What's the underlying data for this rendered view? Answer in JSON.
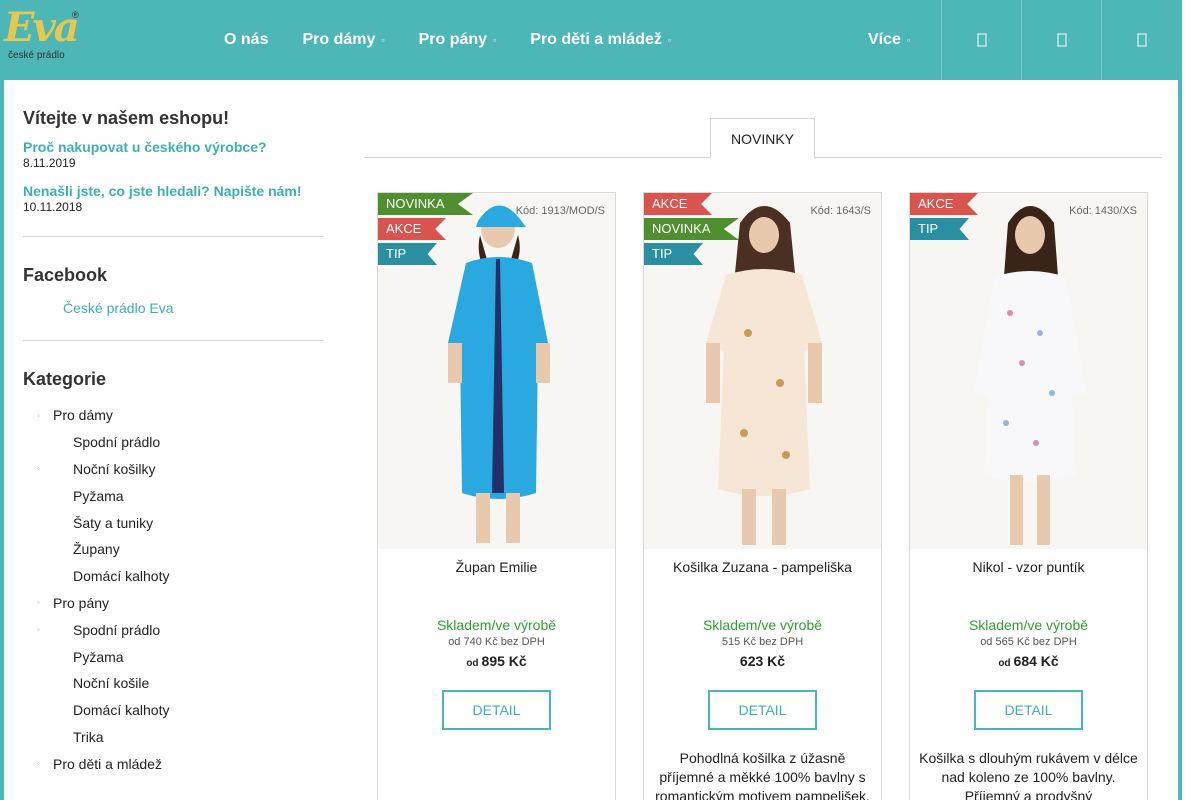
{
  "header": {
    "logo_text": "Eva",
    "logo_reg": "®",
    "logo_sub": "české prádlo",
    "nav": [
      "O nás",
      "Pro dámy",
      "Pro pány",
      "Pro děti a mládež"
    ],
    "nav_more": "Více",
    "icons": [
      "search-icon",
      "user-icon",
      "cart-icon"
    ]
  },
  "sidebar": {
    "welcome_title": "Vítejte v našem eshopu!",
    "news": [
      {
        "title": "Proč nakupovat u českého výrobce?",
        "date": "8.11.2019"
      },
      {
        "title": "Nenašli jste, co jste hledali? Napište nám!",
        "date": "10.11.2018"
      }
    ],
    "facebook_title": "Facebook",
    "facebook_link": "České prádlo Eva",
    "category_title": "Kategorie",
    "categories": [
      {
        "label": "Pro dámy",
        "level": 0
      },
      {
        "label": "Spodní prádlo",
        "level": 1
      },
      {
        "label": "Noční košilky",
        "level": 1
      },
      {
        "label": "Pyžama",
        "level": 1
      },
      {
        "label": "Šaty a tuniky",
        "level": 1
      },
      {
        "label": "Župany",
        "level": 1
      },
      {
        "label": "Domácí kalhoty",
        "level": 1
      },
      {
        "label": "Pro pány",
        "level": 0
      },
      {
        "label": "Spodní prádlo",
        "level": 1
      },
      {
        "label": "Pyžama",
        "level": 1
      },
      {
        "label": "Noční košile",
        "level": 1
      },
      {
        "label": "Domácí kalhoty",
        "level": 1
      },
      {
        "label": "Trika",
        "level": 1
      },
      {
        "label": "Pro děti a mládež",
        "level": 0
      }
    ]
  },
  "tabs": {
    "active": "NOVINKY"
  },
  "products": [
    {
      "badges": [
        "NOVINKA",
        "AKCE",
        "TIP"
      ],
      "code": "Kód: 1913/MOD/S",
      "name": "Župan Emilie",
      "stock": "Skladem/ve výrobě",
      "price_ex": "od 740 Kč bez DPH",
      "price_prefix": "od",
      "price": "895 Kč",
      "detail": "DETAIL",
      "desc": "",
      "colors": {
        "garment": "#2aa9e0",
        "trim": "#22306a"
      }
    },
    {
      "badges": [
        "AKCE",
        "NOVINKA",
        "TIP"
      ],
      "code": "Kód: 1643/S",
      "name": "Košilka Zuzana - pampeliška",
      "stock": "Skladem/ve výrobě",
      "price_ex": "515 Kč bez DPH",
      "price_prefix": "",
      "price": "623 Kč",
      "detail": "DETAIL",
      "desc": "Pohodlná košilka z úžasně příjemné a měkké 100% bavlny s romantickým motivem pampelišek.",
      "colors": {
        "garment": "#f6e6d6",
        "trim": "#c99a5a"
      }
    },
    {
      "badges": [
        "AKCE",
        "TIP"
      ],
      "code": "Kód: 1430/XS",
      "name": "Nikol - vzor puntík",
      "stock": "Skladem/ve výrobě",
      "price_ex": "od 565 Kč bez DPH",
      "price_prefix": "od",
      "price": "684 Kč",
      "detail": "DETAIL",
      "desc": "Košilka s  dlouhým rukávem v délce nad koleno ze 100% bavlny. Příjemný a prodyšný",
      "colors": {
        "garment": "#f8f8fb",
        "trim": "#d88fb0"
      }
    }
  ]
}
